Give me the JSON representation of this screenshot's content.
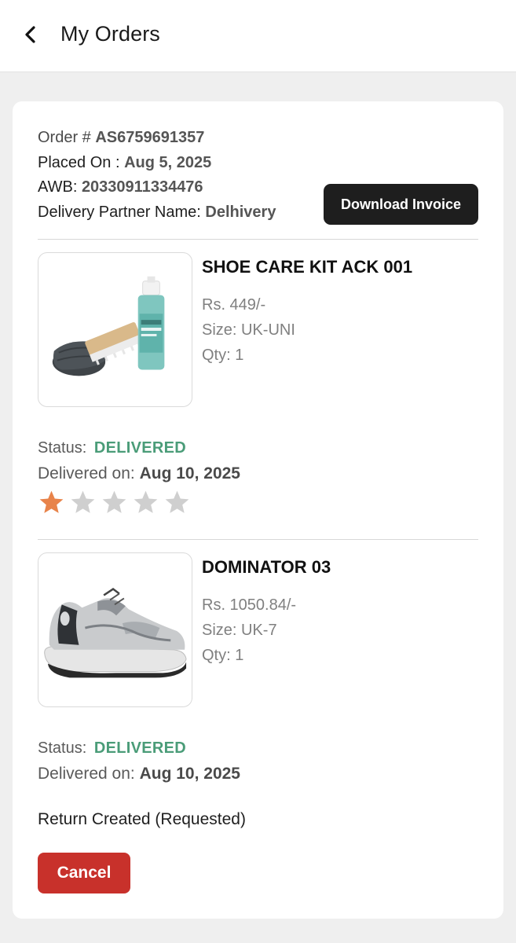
{
  "header": {
    "title": "My Orders",
    "back_icon": "chevron-left-icon"
  },
  "order": {
    "order_label": "Order # ",
    "order_number": "AS6759691357",
    "placed_label": "Placed On : ",
    "placed_date": "Aug 5, 2025",
    "awb_label": "AWB: ",
    "awb_number": "20330911334476",
    "partner_label": "Delivery Partner Name: ",
    "partner_name": "Delhivery",
    "invoice_button": "Download Invoice"
  },
  "items": [
    {
      "name": "SHOE CARE KIT ACK 001",
      "price": "Rs. 449/-",
      "size": "Size: UK-UNI",
      "qty": "Qty: 1",
      "status_label": "Status:",
      "status": "DELIVERED",
      "delivered_label": "Delivered on: ",
      "delivered_date": "Aug 10, 2025",
      "rating": 1,
      "rating_max": 5,
      "image_icon": "shoe-care-kit-image"
    },
    {
      "name": "DOMINATOR 03",
      "price": "Rs. 1050.84/-",
      "size": "Size: UK-7",
      "qty": "Qty: 1",
      "status_label": "Status:",
      "status": "DELIVERED",
      "delivered_label": "Delivered on: ",
      "delivered_date": "Aug 10, 2025",
      "image_icon": "sneaker-image"
    }
  ],
  "return": {
    "text": "Return Created (Requested)",
    "cancel_button": "Cancel"
  },
  "colors": {
    "status_green": "#4a9c78",
    "star_active": "#e8834a",
    "star_inactive": "#cfcfcf",
    "cancel_red": "#c8312b",
    "invoice_dark": "#1e1e1e"
  }
}
